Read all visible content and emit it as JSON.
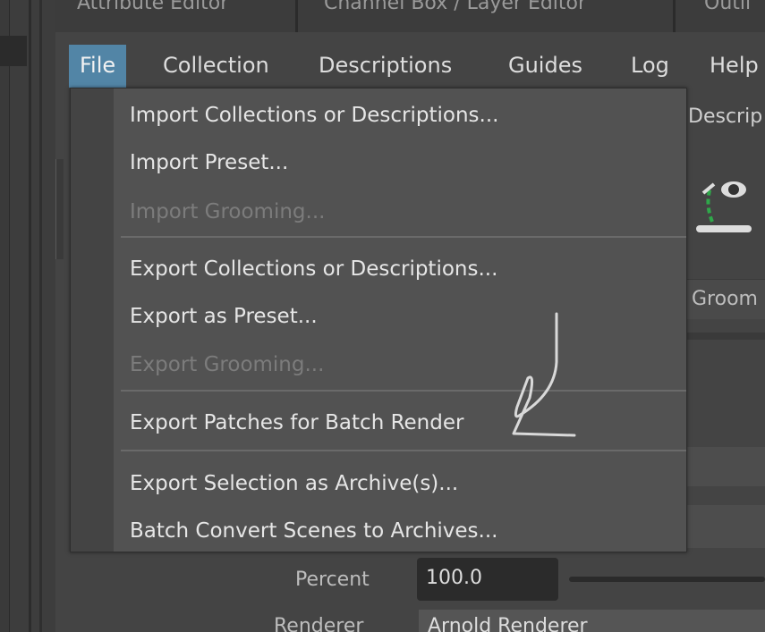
{
  "tabs": [
    {
      "label": "Attribute Editor"
    },
    {
      "label": "Channel Box / Layer Editor"
    },
    {
      "label": "Outli"
    }
  ],
  "menubar": {
    "items": [
      {
        "label": "File",
        "active": true
      },
      {
        "label": "Collection"
      },
      {
        "label": "Descriptions"
      },
      {
        "label": "Guides"
      },
      {
        "label": "Log"
      },
      {
        "label": "Help"
      }
    ]
  },
  "file_menu": {
    "items": [
      {
        "label": "Import Collections or Descriptions...",
        "enabled": true
      },
      {
        "label": "Import Preset...",
        "enabled": true
      },
      {
        "label": "Import Grooming...",
        "enabled": false
      },
      {
        "label": "Export Collections or Descriptions...",
        "enabled": true
      },
      {
        "label": "Export as Preset...",
        "enabled": true
      },
      {
        "label": "Export Grooming...",
        "enabled": false
      },
      {
        "label": "Export Patches for Batch Render",
        "enabled": true
      },
      {
        "label": "Export Selection as Archive(s)...",
        "enabled": true
      },
      {
        "label": "Batch Convert Scenes to Archives...",
        "enabled": true
      }
    ]
  },
  "background": {
    "descrip_text": "Descrip",
    "groom_text": "Groom",
    "percent_label": "Percent",
    "percent_value": "100.0",
    "renderer_label": "Renderer",
    "renderer_value": "Arnold Renderer"
  },
  "colors": {
    "menu_active": "#5285a6",
    "menu_bg": "#525252",
    "disabled_text": "#7c7c7c"
  }
}
